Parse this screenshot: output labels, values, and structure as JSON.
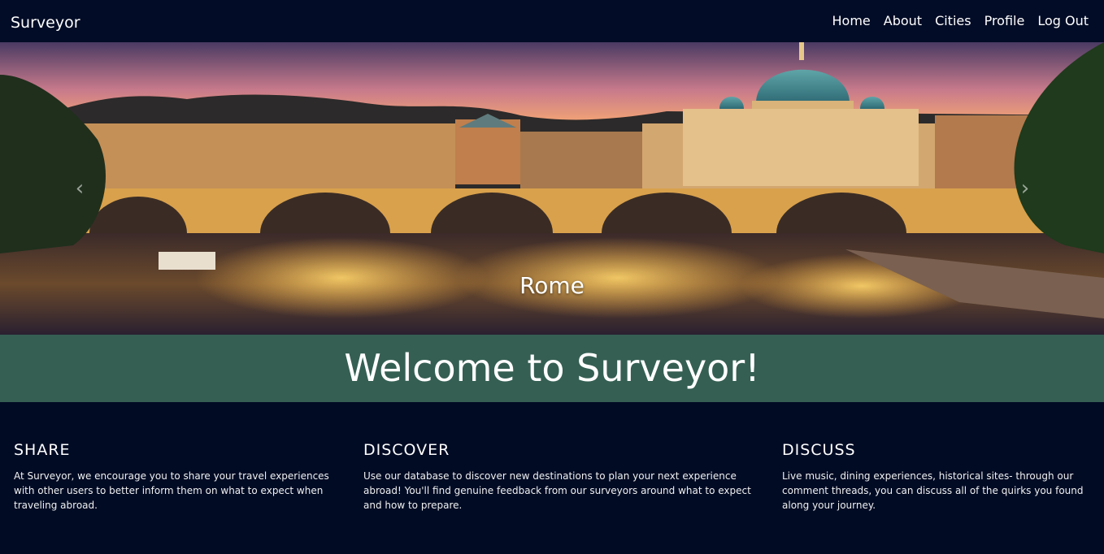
{
  "navbar": {
    "brand": "Surveyor",
    "links": [
      "Home",
      "About",
      "Cities",
      "Profile",
      "Log Out"
    ]
  },
  "carousel": {
    "caption": "Rome",
    "prev_icon": "chevron-left-icon",
    "next_icon": "chevron-right-icon"
  },
  "welcome": {
    "title": "Welcome to Surveyor!"
  },
  "features": [
    {
      "heading": "SHARE",
      "text": "At Surveyor, we encourage you to share your travel experiences with other users to better inform them on what to expect when traveling abroad."
    },
    {
      "heading": "DISCOVER",
      "text": "Use our database to discover new destinations to plan your next experience abroad! You'll find genuine feedback from our surveyors around what to expect and how to prepare."
    },
    {
      "heading": "DISCUSS",
      "text": "Live music, dining experiences, historical sites- through our comment threads, you can discuss all of the quirks you found along your journey."
    }
  ],
  "colors": {
    "navbar_bg": "#020c26",
    "page_bg": "#010b24",
    "welcome_bg": "#355f53"
  }
}
